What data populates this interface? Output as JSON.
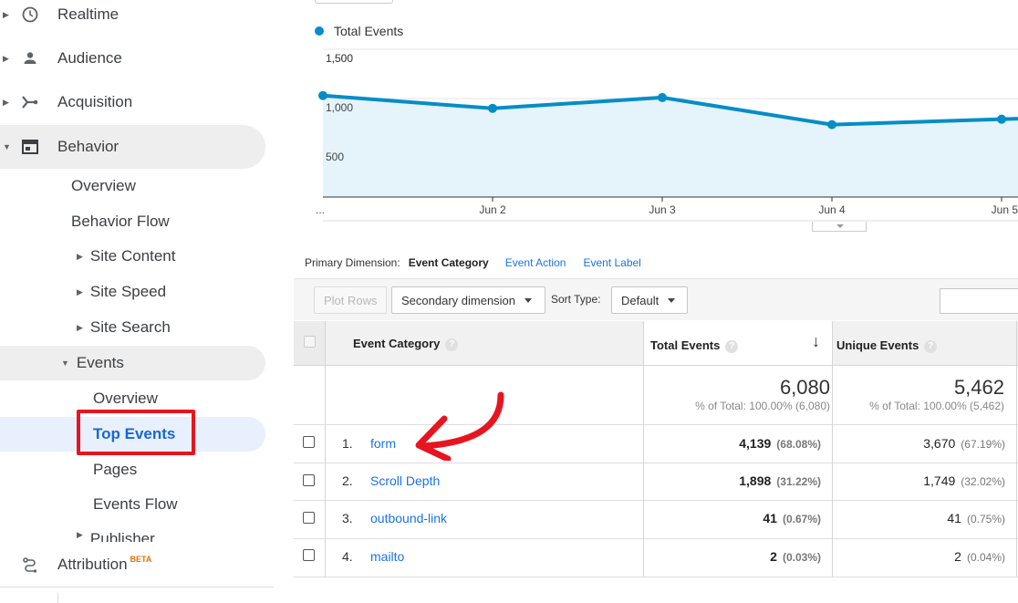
{
  "sidebar": {
    "items": [
      {
        "label": "Realtime",
        "icon": "clock-icon"
      },
      {
        "label": "Audience",
        "icon": "person-icon"
      },
      {
        "label": "Acquisition",
        "icon": "acquisition-icon"
      },
      {
        "label": "Behavior",
        "icon": "behavior-window-icon"
      }
    ],
    "behavior_children": [
      "Overview",
      "Behavior Flow"
    ],
    "behavior_groups": [
      "Site Content",
      "Site Speed",
      "Site Search",
      "Events"
    ],
    "events_children": [
      "Overview",
      "Top Events",
      "Pages",
      "Events Flow"
    ],
    "partial_item": "Publisher",
    "attribution": {
      "label": "Attribution",
      "badge": "BETA",
      "icon": "attribution-icon"
    }
  },
  "chart_data": {
    "type": "line",
    "series": [
      {
        "name": "Total Events",
        "values": [
          1030,
          900,
          1010,
          735,
          790
        ]
      }
    ],
    "x": [
      "...",
      "Jun 2",
      "Jun 3",
      "Jun 4",
      "Jun 5"
    ],
    "y_ticks": [
      "1,500",
      "1,000",
      "500"
    ],
    "ylim": [
      0,
      1500
    ],
    "legend": "top-left",
    "grid": true,
    "color": "#058dc7"
  },
  "dimension_bar": {
    "label": "Primary Dimension:",
    "current": "Event Category",
    "options": [
      "Event Action",
      "Event Label"
    ]
  },
  "toolbar": {
    "plot_rows": "Plot Rows",
    "secondary_dimension": "Secondary dimension",
    "sort_type_label": "Sort Type:",
    "sort_type_value": "Default"
  },
  "table": {
    "headers": {
      "category": "Event Category",
      "total": "Total Events",
      "unique": "Unique Events"
    },
    "totals": {
      "total": "6,080",
      "total_sub": "% of Total: 100.00% (6,080)",
      "unique": "5,462",
      "unique_sub": "% of Total: 100.00% (5,462)"
    },
    "rows": [
      {
        "num": "1.",
        "category": "form",
        "total": "4,139",
        "total_pct": "(68.08%)",
        "unique": "3,670",
        "unique_pct": "(67.19%)"
      },
      {
        "num": "2.",
        "category": "Scroll Depth",
        "total": "1,898",
        "total_pct": "(31.22%)",
        "unique": "1,749",
        "unique_pct": "(32.02%)"
      },
      {
        "num": "3.",
        "category": "outbound-link",
        "total": "41",
        "total_pct": "(0.67%)",
        "unique": "41",
        "unique_pct": "(0.75%)"
      },
      {
        "num": "4.",
        "category": "mailto",
        "total": "2",
        "total_pct": "(0.03%)",
        "unique": "2",
        "unique_pct": "(0.04%)"
      }
    ]
  },
  "annotation": {
    "highlight_color": "#e8141f"
  }
}
